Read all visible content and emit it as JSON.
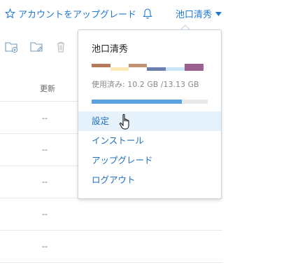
{
  "header": {
    "upgrade_label": "アカウントをアップグレード",
    "user_name": "池口清秀"
  },
  "table": {
    "column_updated": "更新",
    "rows": [
      "--",
      "--",
      "--",
      "--",
      "--"
    ]
  },
  "dropdown": {
    "user_name": "池口清秀",
    "usage_text": "使用済み: 10.2 GB /13.13 GB",
    "usage_fraction": 0.777,
    "items": [
      {
        "label": "設定"
      },
      {
        "label": "インストール"
      },
      {
        "label": "アップグレード"
      },
      {
        "label": "ログアウト"
      }
    ]
  },
  "colors": {
    "accent": "#1f7ad1",
    "bar_fill": "#5aa3df",
    "hover_bg": "#e5f1fb",
    "breakdown_upper": [
      "#b5795a",
      "#ffffff",
      "#c49274",
      "#ffffff",
      "#9b6090"
    ],
    "breakdown_lower": [
      "#ffffff",
      "#fde8b8",
      "#ffffff",
      "#6b7fae",
      "#c9e6f6",
      "#9b6090"
    ]
  }
}
